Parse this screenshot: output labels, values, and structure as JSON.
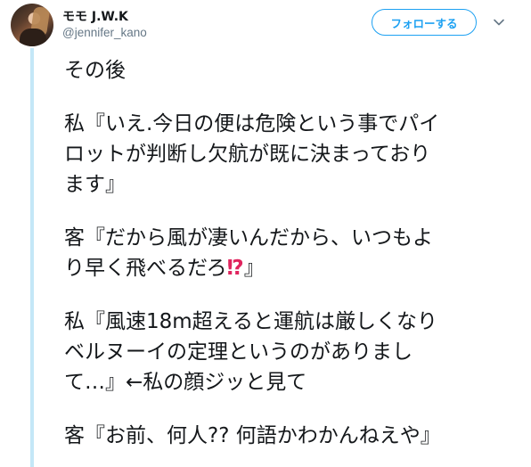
{
  "author": {
    "display_name": "モモ J.W.K",
    "handle": "@jennifer_kano"
  },
  "actions": {
    "follow_label": "フォローする"
  },
  "tweet": {
    "p1": {
      "l1": "その後"
    },
    "p2": {
      "l1": "私『いえ.今日の便は危険という事でパイ",
      "l2": "ロットが判断し欠航が既に決まっており",
      "l3": "ます』"
    },
    "p3": {
      "l1": "客『だから風が凄いんだから、いつもよ",
      "l2a": "り早く飛べるだろ",
      "l2_emoji": "⁉",
      "l2b": "』"
    },
    "p4": {
      "l1": "私『風速18m超えると運航は厳しくなり",
      "l2": "ベルヌーイの定理というのがありまし",
      "l3": "て…』←私の顔ジッと見て"
    },
    "p5": {
      "l1": "客『お前、何人?? 何語かわかんねえや』"
    }
  },
  "colors": {
    "accent": "#1da1f2",
    "thread_line": "#c4e7f7",
    "secondary_text": "#657786",
    "emoji_red": "#e0245e"
  },
  "icons": {
    "caret": "chevron-down-icon",
    "emoji": "exclamation-question-mark-emoji"
  }
}
